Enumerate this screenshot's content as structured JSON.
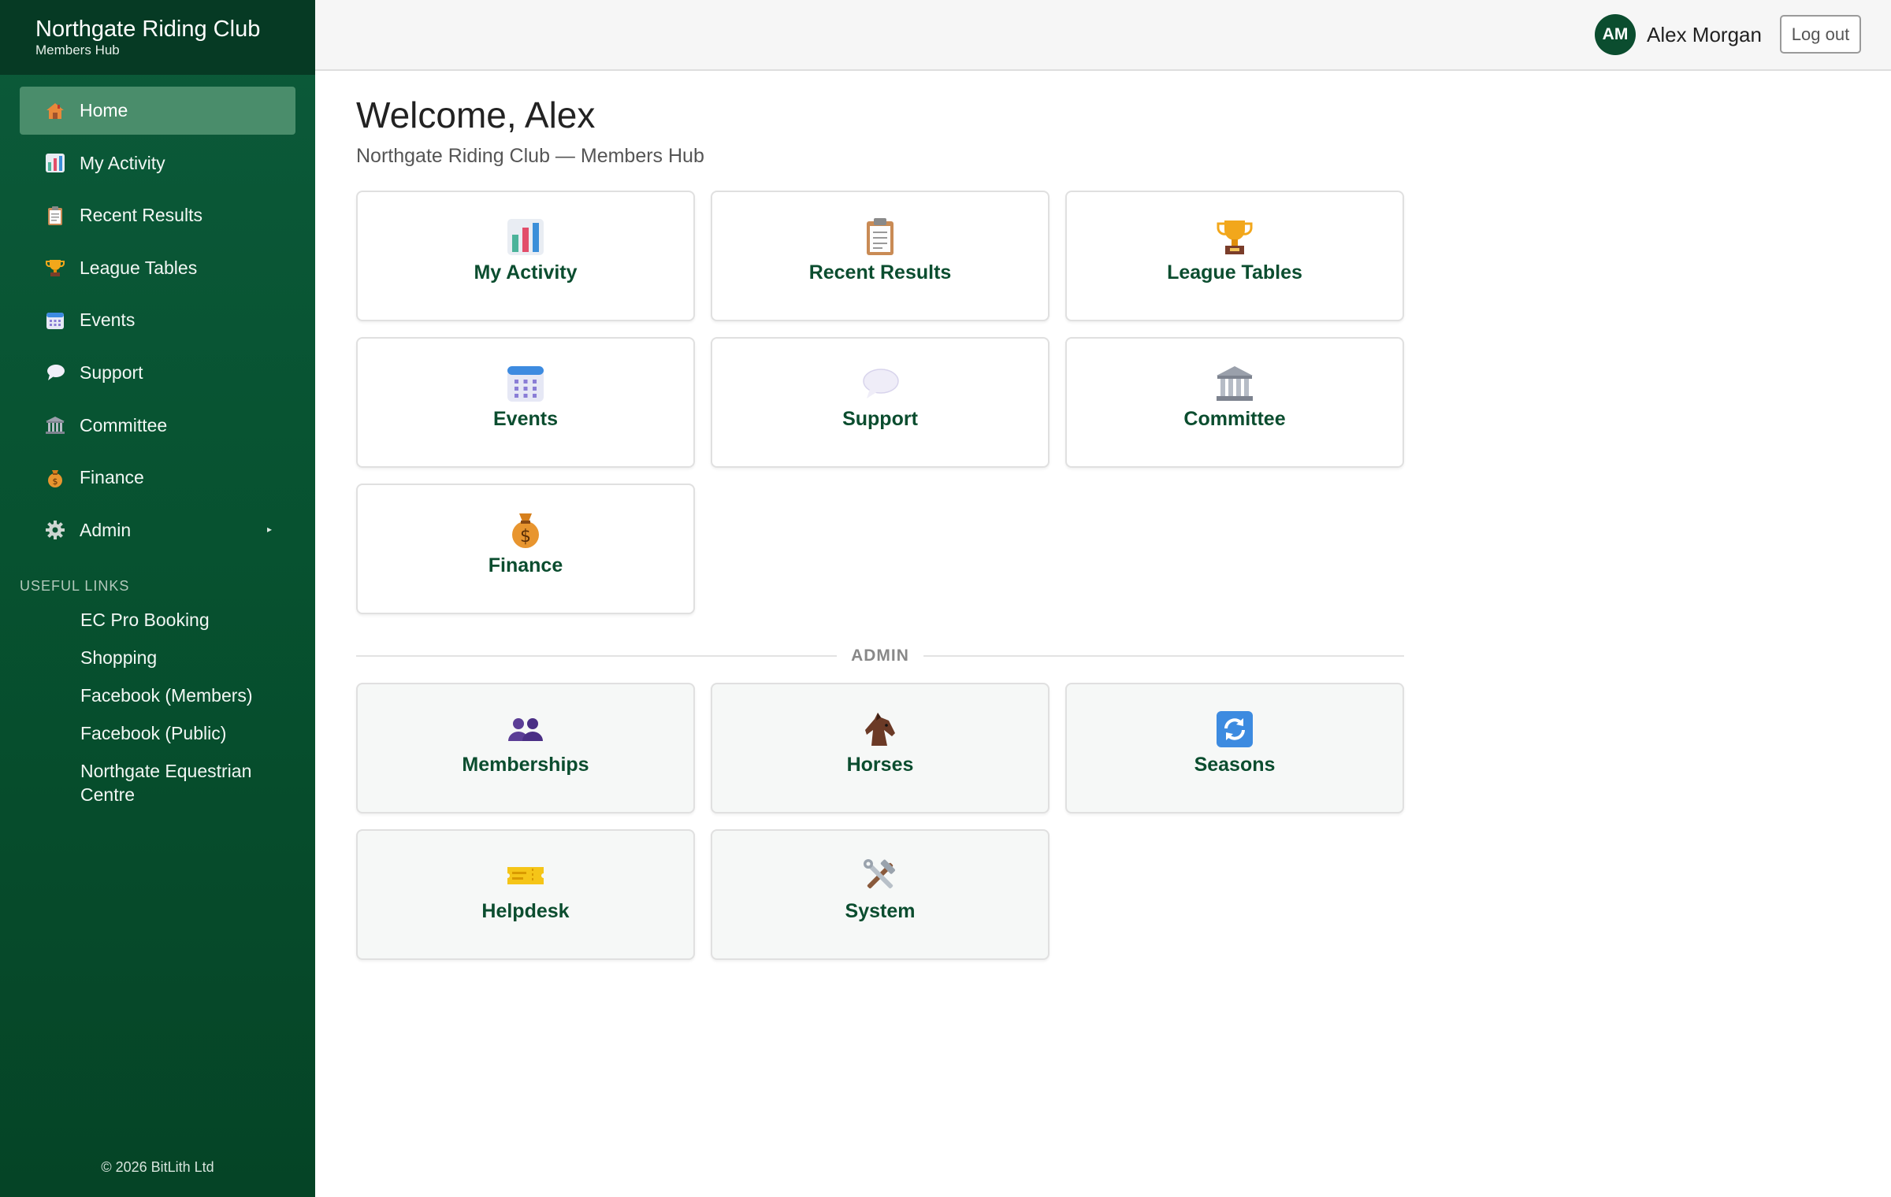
{
  "brand": {
    "title": "Northgate Riding Club",
    "subtitle": "Members Hub"
  },
  "sidebar": {
    "items": [
      {
        "label": "Home",
        "icon": "house-icon",
        "active": true
      },
      {
        "label": "My Activity",
        "icon": "bar-chart-icon"
      },
      {
        "label": "Recent Results",
        "icon": "clipboard-icon"
      },
      {
        "label": "League Tables",
        "icon": "trophy-icon"
      },
      {
        "label": "Events",
        "icon": "calendar-icon"
      },
      {
        "label": "Support",
        "icon": "speech-bubble-icon"
      },
      {
        "label": "Committee",
        "icon": "classical-building-icon"
      },
      {
        "label": "Finance",
        "icon": "money-bag-icon"
      },
      {
        "label": "Admin",
        "icon": "gear-icon",
        "has_submenu": true
      }
    ],
    "useful_links_label": "USEFUL LINKS",
    "links": [
      "EC Pro Booking",
      "Shopping",
      "Facebook (Members)",
      "Facebook (Public)",
      "Northgate Equestrian Centre"
    ],
    "copyright": "© 2026 BitLith Ltd"
  },
  "topbar": {
    "avatar_initials": "AM",
    "user_name": "Alex Morgan",
    "logout_label": "Log out"
  },
  "main": {
    "welcome": "Welcome, Alex",
    "subtitle": "Northgate Riding Club — Members Hub",
    "tiles": [
      {
        "label": "My Activity",
        "icon": "bar-chart-icon"
      },
      {
        "label": "Recent Results",
        "icon": "clipboard-icon"
      },
      {
        "label": "League Tables",
        "icon": "trophy-icon"
      },
      {
        "label": "Events",
        "icon": "calendar-icon"
      },
      {
        "label": "Support",
        "icon": "speech-bubble-icon"
      },
      {
        "label": "Committee",
        "icon": "classical-building-icon"
      },
      {
        "label": "Finance",
        "icon": "money-bag-icon"
      }
    ],
    "admin_label": "ADMIN",
    "admin_tiles": [
      {
        "label": "Memberships",
        "icon": "people-icon"
      },
      {
        "label": "Horses",
        "icon": "horse-head-icon"
      },
      {
        "label": "Seasons",
        "icon": "refresh-icon"
      },
      {
        "label": "Helpdesk",
        "icon": "ticket-icon"
      },
      {
        "label": "System",
        "icon": "tools-icon"
      }
    ]
  },
  "colors": {
    "brand_green": "#0b4d2f",
    "sidebar_active": "#4a8d6b",
    "sidebar_header": "#063a24"
  }
}
